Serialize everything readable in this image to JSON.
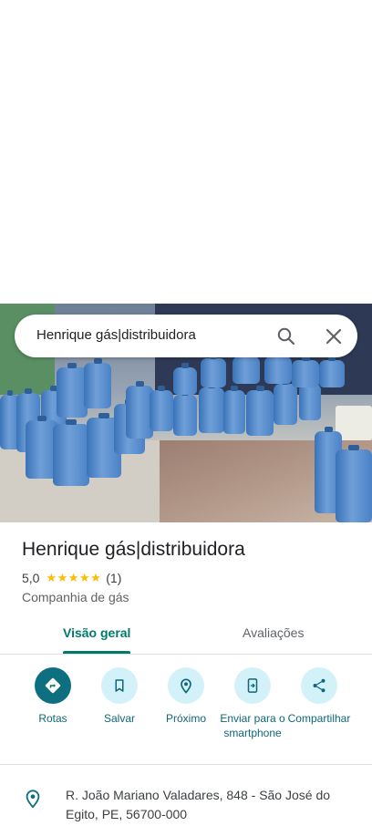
{
  "search": {
    "query": "Henrique gás|distribuidora"
  },
  "place": {
    "name": "Henrique gás|distribuidora",
    "rating": "5,0",
    "stars": "★★★★★",
    "review_count": "(1)",
    "category": "Companhia de gás",
    "address": "R. João Mariano Valadares, 848 - São José do Egito, PE, 56700-000"
  },
  "tabs": [
    {
      "label": "Visão geral",
      "selected": true
    },
    {
      "label": "Avaliações",
      "selected": false
    }
  ],
  "actions": [
    {
      "label": "Rotas",
      "icon": "directions-icon"
    },
    {
      "label": "Salvar",
      "icon": "bookmark-icon"
    },
    {
      "label": "Próximo",
      "icon": "nearby-icon"
    },
    {
      "label": "Enviar para o smartphone",
      "icon": "send-to-phone-icon"
    },
    {
      "label": "Compartilhar",
      "icon": "share-icon"
    }
  ],
  "colors": {
    "accent": "#00796b",
    "primary_button": "#0d6f7f",
    "chip_bg": "#d3f1f8",
    "star": "#fbbc04"
  }
}
